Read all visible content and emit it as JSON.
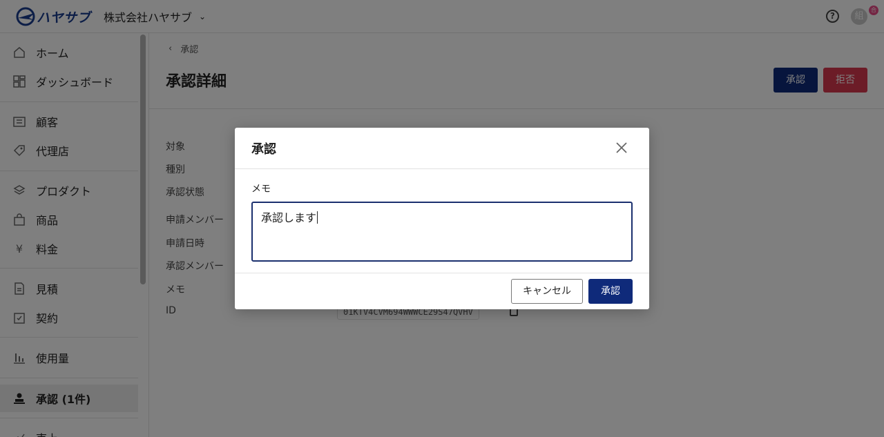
{
  "header": {
    "brand": "ハヤサブ",
    "org_name": "株式会社ハヤサブ",
    "help_glyph": "?",
    "avatar_initial": "組",
    "avatar_badge": "合"
  },
  "sidebar": {
    "items": [
      {
        "label": "ホーム",
        "icon": "home-icon"
      },
      {
        "label": "ダッシュボード",
        "icon": "dashboard-icon"
      },
      {
        "label": "顧客",
        "icon": "customer-icon"
      },
      {
        "label": "代理店",
        "icon": "agency-icon"
      },
      {
        "label": "プロダクト",
        "icon": "product-icon"
      },
      {
        "label": "商品",
        "icon": "goods-icon"
      },
      {
        "label": "料金",
        "icon": "yen-icon"
      },
      {
        "label": "見積",
        "icon": "quote-icon"
      },
      {
        "label": "契約",
        "icon": "contract-icon"
      },
      {
        "label": "使用量",
        "icon": "usage-icon"
      },
      {
        "label": "承認 (1件)",
        "icon": "approval-icon",
        "active": true
      },
      {
        "label": "売上",
        "icon": "sales-icon"
      }
    ]
  },
  "main": {
    "breadcrumb": "承認",
    "title": "承認詳細",
    "approve_label": "承認",
    "reject_label": "拒否",
    "fields": [
      "対象",
      "種別",
      "承認状態",
      "申請メンバー",
      "申請日時",
      "承認メンバー",
      "メモ",
      "ID"
    ],
    "id_value": "01KTV4CVM694WWWCE29S47QVHV"
  },
  "modal": {
    "title": "承認",
    "memo_label": "メモ",
    "memo_value": "承認します",
    "cancel_label": "キャンセル",
    "approve_label": "承認"
  },
  "colors": {
    "primary": "#0f2a7a",
    "danger": "#d9384f",
    "brand": "#1a3d8f"
  }
}
